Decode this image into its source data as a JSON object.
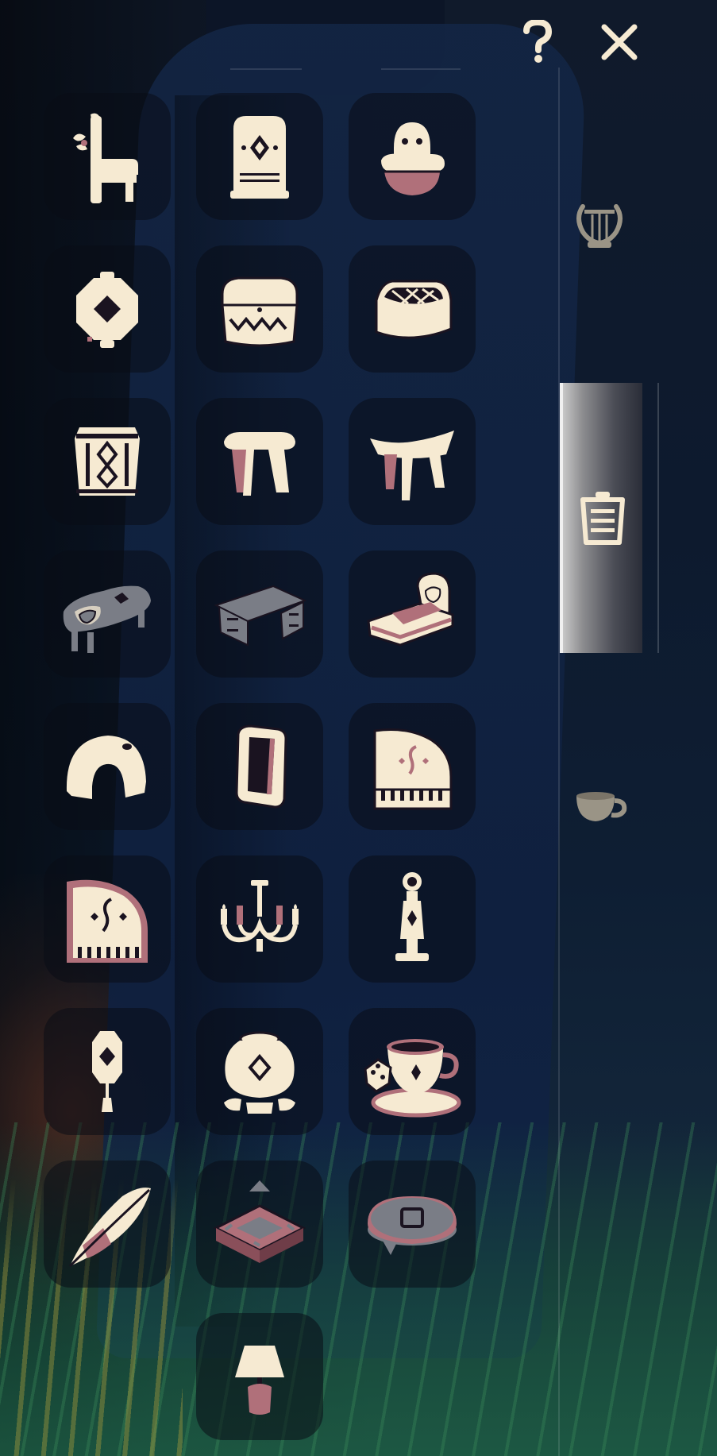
{
  "top_bar": {
    "help_icon": "question-mark-icon",
    "close_icon": "close-x-icon"
  },
  "side_tabs": [
    {
      "icon": "lyre-icon",
      "selected": false
    },
    {
      "icon": "clipboard-list-icon",
      "selected": true
    },
    {
      "icon": "teacup-icon",
      "selected": false
    }
  ],
  "items": [
    {
      "icon": "chair-icon"
    },
    {
      "icon": "ornate-cabinet-icon"
    },
    {
      "icon": "plush-in-basket-icon"
    },
    {
      "icon": "paper-lantern-icon"
    },
    {
      "icon": "patterned-chest-icon"
    },
    {
      "icon": "lattice-chest-icon"
    },
    {
      "icon": "patterned-drum-stool-icon"
    },
    {
      "icon": "wooden-stool-icon"
    },
    {
      "icon": "curved-stool-icon"
    },
    {
      "icon": "coffee-table-icon"
    },
    {
      "icon": "office-desk-icon"
    },
    {
      "icon": "bed-icon"
    },
    {
      "icon": "arched-dome-icon"
    },
    {
      "icon": "mirror-frame-icon"
    },
    {
      "icon": "grand-piano-icon"
    },
    {
      "icon": "grand-piano-pink-icon"
    },
    {
      "icon": "chandelier-icon"
    },
    {
      "icon": "grandfather-clock-icon"
    },
    {
      "icon": "hanging-lantern-icon"
    },
    {
      "icon": "stone-pot-icon"
    },
    {
      "icon": "teacup-and-dice-icon"
    },
    {
      "icon": "feather-quill-icon"
    },
    {
      "icon": "placement-pad-icon"
    },
    {
      "icon": "round-cushion-icon"
    },
    {
      "icon": "table-lamp-icon"
    }
  ],
  "colors": {
    "cream": "#f6ead2",
    "mauve": "#b0707a",
    "dark": "#1a1320",
    "grey": "#7a7d86",
    "tile_bg": "rgba(10,12,22,0.55)",
    "tab_selected": "#9a9ba0"
  }
}
